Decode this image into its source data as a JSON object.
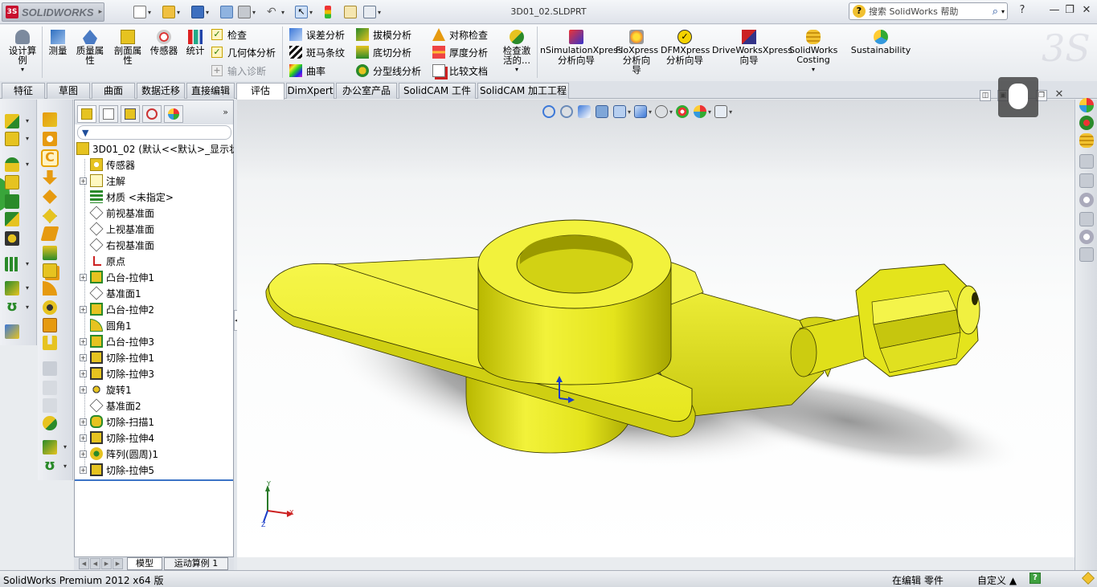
{
  "app": {
    "logo_text": "SOLIDWORKS",
    "document_title": "3D01_02.SLDPRT",
    "help_search_placeholder": "搜索 SolidWorks 帮助",
    "window_controls": [
      "?",
      "—",
      "❐",
      "✕"
    ]
  },
  "ribbon": {
    "big_buttons": [
      {
        "id": "design-study",
        "label_lines": [
          "设计算",
          "例"
        ],
        "icon": "design-study-icon"
      },
      {
        "id": "measure",
        "label_lines": [
          "测量"
        ],
        "icon": "measure-icon"
      },
      {
        "id": "mass-properties",
        "label_lines": [
          "质量属",
          "性"
        ],
        "icon": "mass-properties-icon"
      },
      {
        "id": "section-properties",
        "label_lines": [
          "剖面属",
          "性"
        ],
        "icon": "section-properties-icon"
      },
      {
        "id": "sensor",
        "label_lines": [
          "传感器"
        ],
        "icon": "sensor-icon"
      },
      {
        "id": "statistics",
        "label_lines": [
          "统计"
        ],
        "icon": "statistics-icon"
      }
    ],
    "check_group": [
      {
        "label": "检查",
        "enabled": true
      },
      {
        "label": "几何体分析",
        "enabled": true
      },
      {
        "label": "输入诊断",
        "enabled": false
      }
    ],
    "analysis_col1": [
      {
        "label": "误差分析",
        "icon": "deviation-analysis-icon"
      },
      {
        "label": "斑马条纹",
        "icon": "zebra-stripes-icon"
      },
      {
        "label": "曲率",
        "icon": "curvature-icon"
      }
    ],
    "analysis_col2": [
      {
        "label": "拔模分析",
        "icon": "draft-analysis-icon"
      },
      {
        "label": "底切分析",
        "icon": "undercut-analysis-icon"
      },
      {
        "label": "分型线分析",
        "icon": "parting-line-analysis-icon"
      }
    ],
    "analysis_col3": [
      {
        "label": "对称检查",
        "icon": "symmetry-check-icon"
      },
      {
        "label": "厚度分析",
        "icon": "thickness-analysis-icon"
      },
      {
        "label": "比较文档",
        "icon": "compare-documents-icon"
      }
    ],
    "check_active": {
      "label_lines": [
        "检查激",
        "活的..."
      ]
    },
    "xpress": [
      {
        "id": "simulationxpress",
        "label_lines": [
          "nSimulationXpress",
          "分析向导"
        ]
      },
      {
        "id": "floxpress",
        "label_lines": [
          "FloXpress",
          "分析向",
          "导"
        ]
      },
      {
        "id": "dfmxpress",
        "label_lines": [
          "DFMXpress",
          "分析向导"
        ]
      },
      {
        "id": "driveworksxpress",
        "label_lines": [
          "DriveWorksXpress",
          "向导"
        ]
      },
      {
        "id": "costing",
        "label_lines": [
          "SolidWorks",
          "Costing"
        ]
      },
      {
        "id": "sustainability",
        "label_lines": [
          "Sustainability"
        ]
      }
    ]
  },
  "tabs": [
    {
      "label": "特征",
      "active": false
    },
    {
      "label": "草图",
      "active": false
    },
    {
      "label": "曲面",
      "active": false
    },
    {
      "label": "数据迁移",
      "active": false
    },
    {
      "label": "直接编辑",
      "active": false
    },
    {
      "label": "评估",
      "active": true
    },
    {
      "label": "DimXpert",
      "active": false
    },
    {
      "label": "办公室产品",
      "active": false
    },
    {
      "label": "SolidCAM 工件",
      "active": false
    },
    {
      "label": "SolidCAM 加工工程",
      "active": false
    }
  ],
  "feature_tree": {
    "root": "3D01_02  (默认<<默认>_显示状",
    "nodes": [
      {
        "label": "传感器",
        "icon": "sensor-folder-icon",
        "expandable": false
      },
      {
        "label": "注解",
        "icon": "annotations-icon",
        "expandable": true
      },
      {
        "label": "材质 <未指定>",
        "icon": "material-icon",
        "expandable": false
      },
      {
        "label": "前视基准面",
        "icon": "plane-icon",
        "expandable": false
      },
      {
        "label": "上视基准面",
        "icon": "plane-icon",
        "expandable": false
      },
      {
        "label": "右视基准面",
        "icon": "plane-icon",
        "expandable": false
      },
      {
        "label": "原点",
        "icon": "origin-icon",
        "expandable": false
      },
      {
        "label": "凸台-拉伸1",
        "icon": "boss-extrude-icon",
        "expandable": true
      },
      {
        "label": "基准面1",
        "icon": "plane-icon",
        "expandable": false
      },
      {
        "label": "凸台-拉伸2",
        "icon": "boss-extrude-icon",
        "expandable": true
      },
      {
        "label": "圆角1",
        "icon": "fillet-icon",
        "expandable": false
      },
      {
        "label": "凸台-拉伸3",
        "icon": "boss-extrude-icon",
        "expandable": true
      },
      {
        "label": "切除-拉伸1",
        "icon": "cut-extrude-icon",
        "expandable": true
      },
      {
        "label": "切除-拉伸3",
        "icon": "cut-extrude-icon",
        "expandable": true
      },
      {
        "label": "旋转1",
        "icon": "revolve-icon",
        "expandable": true
      },
      {
        "label": "基准面2",
        "icon": "plane-icon",
        "expandable": false
      },
      {
        "label": "切除-扫描1",
        "icon": "cut-sweep-icon",
        "expandable": true
      },
      {
        "label": "切除-拉伸4",
        "icon": "cut-extrude-icon",
        "expandable": true
      },
      {
        "label": "阵列(圆周)1",
        "icon": "circular-pattern-icon",
        "expandable": true
      },
      {
        "label": "切除-拉伸5",
        "icon": "cut-extrude-icon",
        "expandable": true
      }
    ]
  },
  "model_tabs": [
    {
      "label": "模型",
      "active": true
    },
    {
      "label": "运动算例 1",
      "active": false
    }
  ],
  "triad": {
    "x": "X",
    "y": "Y",
    "z": "Z"
  },
  "status": {
    "product": "SolidWorks Premium 2012 x64 版",
    "mode": "在编辑 零件",
    "units": "自定义  ▲",
    "help": "?"
  },
  "colors": {
    "part_yellow": "#e6e61e",
    "accent_blue": "#3b73c6"
  }
}
